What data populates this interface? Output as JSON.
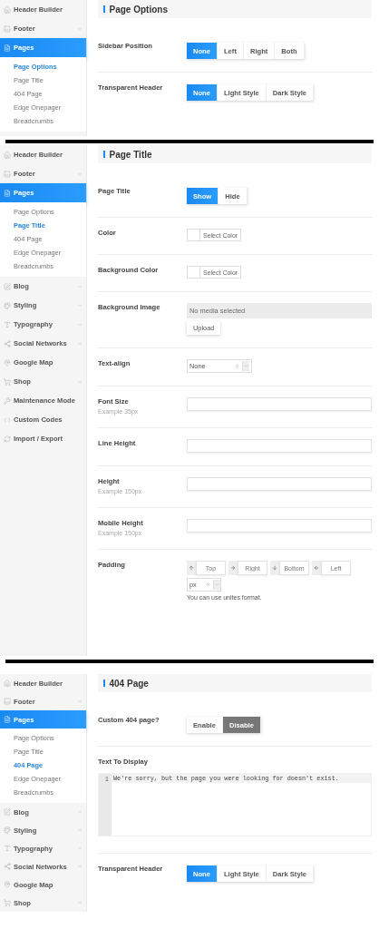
{
  "panels": [
    {
      "sidebar": [
        {
          "label": "Header Builder",
          "expandable": false,
          "selected": false
        },
        {
          "label": "Footer",
          "expandable": true,
          "selected": false
        },
        {
          "label": "Pages",
          "expandable": false,
          "selected": true,
          "children": [
            {
              "label": "Page Options",
              "selected": true
            },
            {
              "label": "Page Title",
              "selected": false
            },
            {
              "label": "404 Page",
              "selected": false
            },
            {
              "label": "Edge Onepager",
              "selected": false
            },
            {
              "label": "Breadcrumbs",
              "selected": false
            }
          ]
        }
      ],
      "section": {
        "title": "Page Options",
        "fields": [
          {
            "kind": "segmented",
            "label": "Sidebar Position",
            "options": [
              {
                "label": "None",
                "selected": true
              },
              {
                "label": "Left",
                "selected": false
              },
              {
                "label": "Right",
                "selected": false
              },
              {
                "label": "Both",
                "selected": false
              }
            ]
          },
          {
            "kind": "segmented",
            "label": "Transparent Header",
            "options": [
              {
                "label": "None",
                "selected": true
              },
              {
                "label": "Light Style",
                "selected": false
              },
              {
                "label": "Dark Style",
                "selected": false
              }
            ]
          }
        ]
      }
    },
    {
      "sidebar": [
        {
          "label": "Header Builder",
          "expandable": false,
          "selected": false
        },
        {
          "label": "Footer",
          "expandable": true,
          "selected": false
        },
        {
          "label": "Pages",
          "expandable": false,
          "selected": true,
          "children": [
            {
              "label": "Page Options",
              "selected": false
            },
            {
              "label": "Page Title",
              "selected": true
            },
            {
              "label": "404 Page",
              "selected": false
            },
            {
              "label": "Edge Onepager",
              "selected": false
            },
            {
              "label": "Breadcrumbs",
              "selected": false
            }
          ]
        },
        {
          "label": "Blog",
          "expandable": true,
          "selected": false
        },
        {
          "label": "Styling",
          "expandable": true,
          "selected": false
        },
        {
          "label": "Typography",
          "expandable": true,
          "selected": false
        },
        {
          "label": "Social Networks",
          "expandable": true,
          "selected": false
        },
        {
          "label": "Google Map",
          "expandable": false,
          "selected": false
        },
        {
          "label": "Shop",
          "expandable": true,
          "selected": false
        },
        {
          "label": "Maintenance Mode",
          "expandable": false,
          "selected": false
        },
        {
          "label": "Custom Codes",
          "expandable": false,
          "selected": false
        },
        {
          "label": "Import / Export",
          "expandable": false,
          "selected": false
        }
      ],
      "section": {
        "title": "Page Title",
        "fields": [
          {
            "kind": "segmented",
            "label": "Page Title",
            "options": [
              {
                "label": "Show",
                "selected": true
              },
              {
                "label": "Hide",
                "selected": false
              }
            ]
          },
          {
            "kind": "color",
            "label": "Color",
            "button": "Select Color"
          },
          {
            "kind": "color",
            "label": "Background Color",
            "button": "Select Color"
          },
          {
            "kind": "media",
            "label": "Background Image",
            "placeholder": "No media selected",
            "button": "Upload"
          },
          {
            "kind": "select",
            "label": "Text-align",
            "value": "None"
          },
          {
            "kind": "text",
            "label": "Font Size",
            "hint": "Example 35px"
          },
          {
            "kind": "text",
            "label": "Line Height"
          },
          {
            "kind": "text",
            "label": "Height",
            "hint": "Example 150px"
          },
          {
            "kind": "text",
            "label": "Mobile Height",
            "hint": "Example 150px"
          },
          {
            "kind": "padding",
            "label": "Padding",
            "inputs": [
              {
                "placeholder": "Top"
              },
              {
                "placeholder": "Right"
              },
              {
                "placeholder": "Bottom"
              },
              {
                "placeholder": "Left"
              }
            ],
            "unit": "px",
            "help": "You can use unites format."
          }
        ]
      }
    },
    {
      "sidebar": [
        {
          "label": "Header Builder",
          "expandable": false,
          "selected": false
        },
        {
          "label": "Footer",
          "expandable": true,
          "selected": false
        },
        {
          "label": "Pages",
          "expandable": false,
          "selected": true,
          "children": [
            {
              "label": "Page Options",
              "selected": false
            },
            {
              "label": "Page Title",
              "selected": false
            },
            {
              "label": "404 Page",
              "selected": true
            },
            {
              "label": "Edge Onepager",
              "selected": false
            },
            {
              "label": "Breadcrumbs",
              "selected": false
            }
          ]
        },
        {
          "label": "Blog",
          "expandable": true,
          "selected": false
        },
        {
          "label": "Styling",
          "expandable": true,
          "selected": false
        },
        {
          "label": "Typography",
          "expandable": true,
          "selected": false
        },
        {
          "label": "Social Networks",
          "expandable": true,
          "selected": false
        },
        {
          "label": "Google Map",
          "expandable": false,
          "selected": false
        },
        {
          "label": "Shop",
          "expandable": true,
          "selected": false
        }
      ],
      "section": {
        "title": "404 Page",
        "fields": [
          {
            "kind": "switch",
            "label": "Custom 404 page?",
            "options": [
              {
                "label": "Enable",
                "selected": false
              },
              {
                "label": "Disable",
                "selected": true
              }
            ]
          },
          {
            "kind": "code",
            "label": "Text To Display",
            "lines": [
              {
                "number": "1",
                "text": "We're sorry, but the page you were looking for doesn't exist."
              }
            ]
          },
          {
            "kind": "segmented",
            "label": "Transparent Header",
            "options": [
              {
                "label": "None",
                "selected": true
              },
              {
                "label": "Light Style",
                "selected": false
              },
              {
                "label": "Dark Style",
                "selected": false
              }
            ]
          }
        ]
      }
    }
  ]
}
